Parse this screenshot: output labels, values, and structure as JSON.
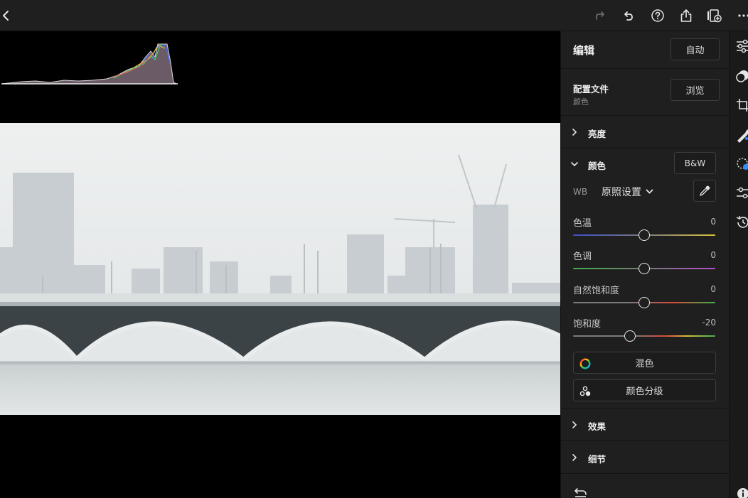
{
  "panel": {
    "title": "编辑",
    "auto_label": "自动",
    "profile": {
      "label": "配置文件",
      "value": "颜色",
      "browse_label": "浏览"
    },
    "light": {
      "label": "亮度"
    },
    "color": {
      "label": "颜色",
      "bw_label": "B&W",
      "wb_label": "WB",
      "wb_value": "原照设置",
      "sliders": [
        {
          "label": "色温",
          "value": "0",
          "level": 0.5
        },
        {
          "label": "色调",
          "value": "0",
          "level": 0.5
        },
        {
          "label": "自然饱和度",
          "value": "0",
          "level": 0.5
        },
        {
          "label": "饱和度",
          "value": "-20",
          "level": 0.4
        }
      ],
      "mix_label": "混色",
      "grading_label": "颜色分级"
    },
    "effects": {
      "label": "效果"
    },
    "detail": {
      "label": "细节"
    }
  },
  "toolbar": {
    "icons": [
      "back-icon",
      "redo-icon",
      "undo-icon",
      "help-icon",
      "share-icon",
      "add-to-album-icon",
      "more-icon"
    ]
  },
  "strip": {
    "icons": [
      "edit-sliders-icon",
      "presets-icon",
      "crop-icon",
      "healing-icon",
      "masking-icon",
      "versions-icon",
      "history-icon",
      "info-icon"
    ]
  },
  "colors": {
    "panel_bg": "#1f1f1f",
    "text": "#e6e6e6",
    "accent": "#ffffff"
  }
}
